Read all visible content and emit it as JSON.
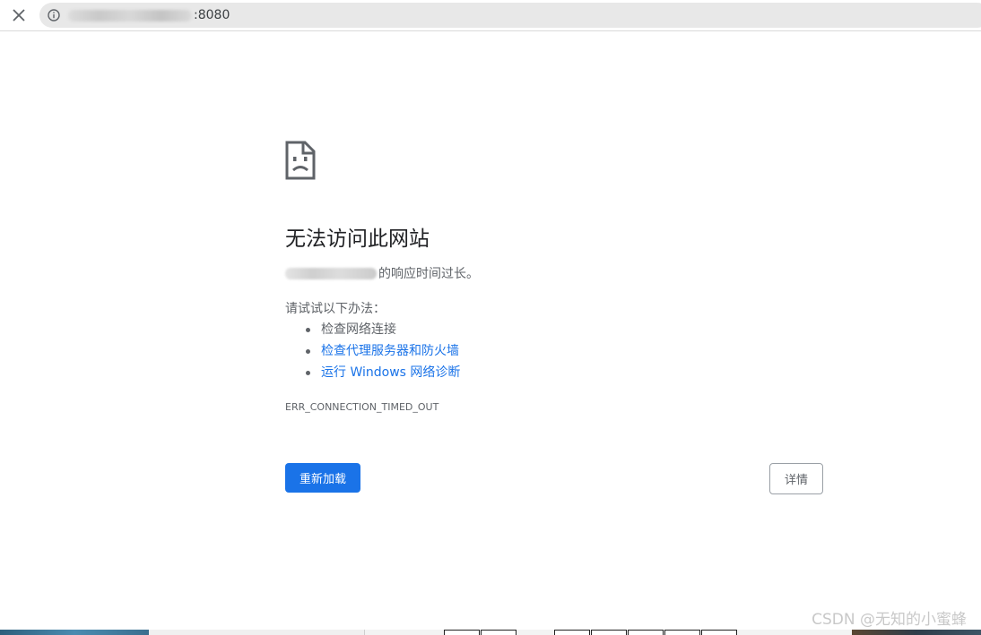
{
  "browser": {
    "url_suffix": ":8080",
    "close_icon": "close-icon",
    "info_icon": "info-icon"
  },
  "error_page": {
    "icon": "sad-page-icon",
    "title": "无法访问此网站",
    "subtitle_suffix": "的响应时间过长。",
    "try_label": "请试试以下办法：",
    "suggestions": [
      {
        "label": "检查网络连接",
        "link": false
      },
      {
        "label": "检查代理服务器和防火墙",
        "link": true
      },
      {
        "label": "运行 Windows 网络诊断",
        "link": true
      }
    ],
    "error_code": "ERR_CONNECTION_TIMED_OUT",
    "reload_label": "重新加载",
    "details_label": "详情"
  },
  "watermark": "CSDN @无知的小蜜蜂",
  "colors": {
    "primary_blue": "#1a73e8",
    "secondary_text": "#5f6368",
    "omnibox_bg": "#e8e8e8"
  }
}
